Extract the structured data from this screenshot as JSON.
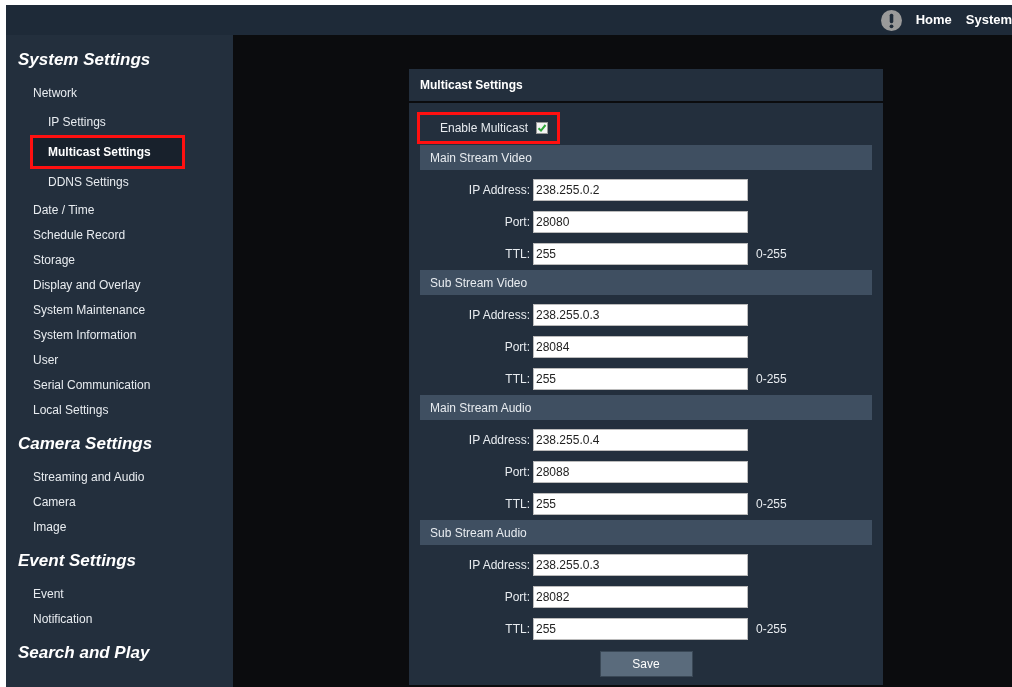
{
  "top_bar": {
    "links": [
      "Home",
      "System"
    ]
  },
  "sidebar": {
    "sections": [
      {
        "title": "System Settings",
        "items": [
          {
            "label": "Network",
            "selected": false,
            "highlighted": false,
            "children": [
              {
                "label": "IP Settings",
                "selected": false,
                "highlighted": false
              },
              {
                "label": "Multicast Settings",
                "selected": true,
                "highlighted": true
              },
              {
                "label": "DDNS Settings",
                "selected": false,
                "highlighted": false
              }
            ]
          },
          {
            "label": "Date / Time",
            "selected": false,
            "highlighted": false
          },
          {
            "label": "Schedule Record",
            "selected": false,
            "highlighted": false
          },
          {
            "label": "Storage",
            "selected": false,
            "highlighted": false
          },
          {
            "label": "Display and Overlay",
            "selected": false,
            "highlighted": false
          },
          {
            "label": "System Maintenance",
            "selected": false,
            "highlighted": false
          },
          {
            "label": "System Information",
            "selected": false,
            "highlighted": false
          },
          {
            "label": "User",
            "selected": false,
            "highlighted": false
          },
          {
            "label": "Serial Communication",
            "selected": false,
            "highlighted": false
          },
          {
            "label": "Local Settings",
            "selected": false,
            "highlighted": false
          }
        ]
      },
      {
        "title": "Camera Settings",
        "items": [
          {
            "label": "Streaming and Audio",
            "selected": false,
            "highlighted": false
          },
          {
            "label": "Camera",
            "selected": false,
            "highlighted": false
          },
          {
            "label": "Image",
            "selected": false,
            "highlighted": false
          }
        ]
      },
      {
        "title": "Event Settings",
        "items": [
          {
            "label": "Event",
            "selected": false,
            "highlighted": false
          },
          {
            "label": "Notification",
            "selected": false,
            "highlighted": false
          }
        ]
      },
      {
        "title": "Search and Play"
      }
    ]
  },
  "panel": {
    "title": "Multicast Settings",
    "enable": {
      "label": "Enable Multicast",
      "checked": true,
      "highlighted": true
    },
    "groups": [
      {
        "title": "Main Stream Video",
        "fields": [
          {
            "label": "IP Address:",
            "value": "238.255.0.2"
          },
          {
            "label": "Port:",
            "value": "28080"
          },
          {
            "label": "TTL:",
            "value": "255",
            "range": "0-255"
          }
        ]
      },
      {
        "title": "Sub Stream Video",
        "fields": [
          {
            "label": "IP Address:",
            "value": "238.255.0.3"
          },
          {
            "label": "Port:",
            "value": "28084"
          },
          {
            "label": "TTL:",
            "value": "255",
            "range": "0-255"
          }
        ]
      },
      {
        "title": "Main Stream Audio",
        "fields": [
          {
            "label": "IP Address:",
            "value": "238.255.0.4"
          },
          {
            "label": "Port:",
            "value": "28088"
          },
          {
            "label": "TTL:",
            "value": "255",
            "range": "0-255"
          }
        ]
      },
      {
        "title": "Sub Stream Audio",
        "fields": [
          {
            "label": "IP Address:",
            "value": "238.255.0.3"
          },
          {
            "label": "Port:",
            "value": "28082"
          },
          {
            "label": "TTL:",
            "value": "255",
            "range": "0-255"
          }
        ]
      }
    ],
    "save_button": "Save"
  }
}
